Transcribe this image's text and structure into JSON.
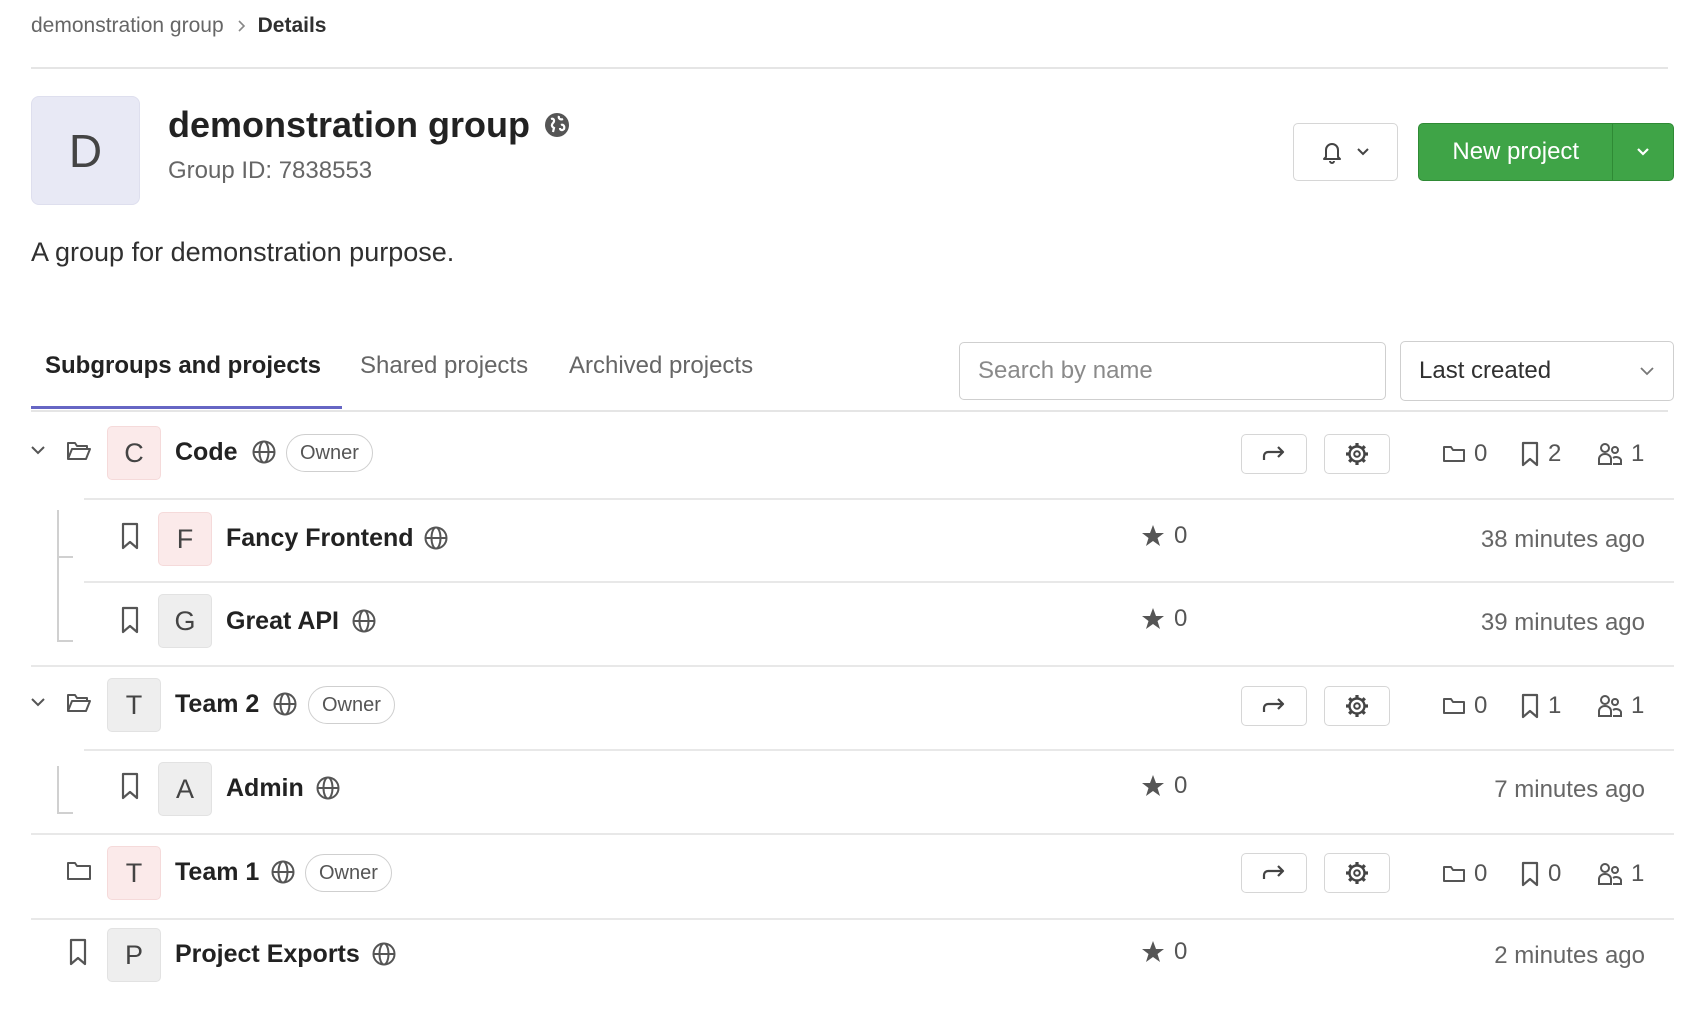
{
  "breadcrumb": {
    "parent": "demonstration group",
    "current": "Details"
  },
  "group": {
    "avatar_letter": "D",
    "title": "demonstration group",
    "id_text": "Group ID: 7838553",
    "description": "A group for demonstration purpose."
  },
  "header_actions": {
    "new_project_label": "New project"
  },
  "tabs": [
    {
      "label": "Subgroups and projects",
      "active": true
    },
    {
      "label": "Shared projects",
      "active": false
    },
    {
      "label": "Archived projects",
      "active": false
    }
  ],
  "search": {
    "placeholder": "Search by name",
    "value": ""
  },
  "sort": {
    "selected": "Last created"
  },
  "items": [
    {
      "kind": "group",
      "expanded": true,
      "letter": "C",
      "name": "Code",
      "badge": "Owner",
      "subgroups": "0",
      "projects": "2",
      "members": "1"
    },
    {
      "kind": "project",
      "letter": "F",
      "name": "Fancy Frontend",
      "stars": "0",
      "updated": "38 minutes ago"
    },
    {
      "kind": "project",
      "letter": "G",
      "name": "Great API",
      "stars": "0",
      "updated": "39 minutes ago"
    },
    {
      "kind": "group",
      "expanded": true,
      "letter": "T",
      "name": "Team 2",
      "badge": "Owner",
      "subgroups": "0",
      "projects": "1",
      "members": "1"
    },
    {
      "kind": "project",
      "letter": "A",
      "name": "Admin",
      "stars": "0",
      "updated": "7 minutes ago"
    },
    {
      "kind": "group",
      "expanded": false,
      "letter": "T",
      "name": "Team 1",
      "badge": "Owner",
      "subgroups": "0",
      "projects": "0",
      "members": "1"
    },
    {
      "kind": "project",
      "letter": "P",
      "name": "Project Exports",
      "stars": "0",
      "updated": "2 minutes ago"
    }
  ],
  "colors": {
    "primary_green": "#3fa447",
    "tab_accent": "#6666c4",
    "avatar_pink": "#fbeaea",
    "avatar_grey": "#eeeeee"
  },
  "icons": [
    "globe-icon",
    "bell-icon",
    "chevron-down-icon",
    "chevron-right-icon",
    "folder-icon",
    "bookmark-icon",
    "star-icon",
    "leave-icon",
    "gear-icon",
    "users-icon"
  ]
}
